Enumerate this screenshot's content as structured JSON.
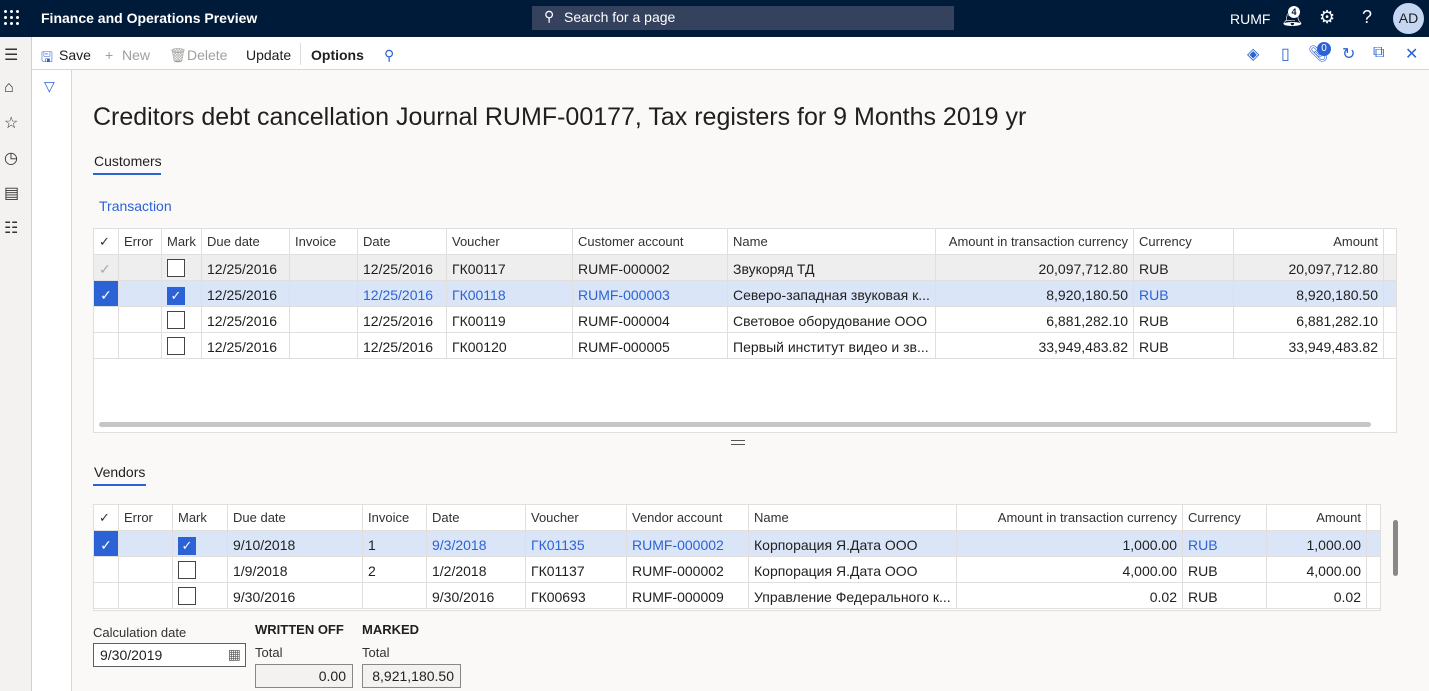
{
  "header": {
    "app_title": "Finance and Operations Preview",
    "search_placeholder": "Search for a page",
    "company": "RUMF",
    "notification_count": "4",
    "avatar_initials": "AD"
  },
  "actions": {
    "save": "Save",
    "new": "New",
    "delete": "Delete",
    "update": "Update",
    "options": "Options",
    "attachments_count": "0"
  },
  "page_title": "Creditors debt cancellation Journal RUMF-00177, Tax registers for 9 Months 2019 yr",
  "customers": {
    "section": "Customers",
    "tab": "Transaction",
    "columns": [
      "Error",
      "Mark",
      "Due date",
      "Invoice",
      "Date",
      "Voucher",
      "Customer account",
      "Name",
      "Amount in transaction currency",
      "Currency",
      "Amount"
    ],
    "rows": [
      {
        "selected": false,
        "marked": false,
        "due_date": "12/25/2016",
        "invoice": "",
        "date": "12/25/2016",
        "voucher": "ГК00117",
        "account": "RUMF-000002",
        "name": "Звукоряд ТД",
        "amount_tx": "20,097,712.80",
        "currency": "RUB",
        "amount": "20,097,712.80"
      },
      {
        "selected": true,
        "marked": true,
        "due_date": "12/25/2016",
        "invoice": "",
        "date": "12/25/2016",
        "voucher": "ГК00118",
        "account": "RUMF-000003",
        "name": "Северо-западная звуковая к...",
        "amount_tx": "8,920,180.50",
        "currency": "RUB",
        "amount": "8,920,180.50"
      },
      {
        "selected": false,
        "marked": false,
        "due_date": "12/25/2016",
        "invoice": "",
        "date": "12/25/2016",
        "voucher": "ГК00119",
        "account": "RUMF-000004",
        "name": "Световое оборудование ООО",
        "amount_tx": "6,881,282.10",
        "currency": "RUB",
        "amount": "6,881,282.10"
      },
      {
        "selected": false,
        "marked": false,
        "due_date": "12/25/2016",
        "invoice": "",
        "date": "12/25/2016",
        "voucher": "ГК00120",
        "account": "RUMF-000005",
        "name": "Первый институт видео и зв...",
        "amount_tx": "33,949,483.82",
        "currency": "RUB",
        "amount": "33,949,483.82"
      }
    ]
  },
  "vendors": {
    "section": "Vendors",
    "columns": [
      "Error",
      "Mark",
      "Due date",
      "Invoice",
      "Date",
      "Voucher",
      "Vendor account",
      "Name",
      "Amount in transaction currency",
      "Currency",
      "Amount"
    ],
    "rows": [
      {
        "selected": true,
        "marked": true,
        "due_date": "9/10/2018",
        "invoice": "1",
        "date": "9/3/2018",
        "voucher": "ГК01135",
        "account": "RUMF-000002",
        "name": "Корпорация Я.Дата ООО",
        "amount_tx": "1,000.00",
        "currency": "RUB",
        "amount": "1,000.00"
      },
      {
        "selected": false,
        "marked": false,
        "due_date": "1/9/2018",
        "invoice": "2",
        "date": "1/2/2018",
        "voucher": "ГК01137",
        "account": "RUMF-000002",
        "name": "Корпорация Я.Дата ООО",
        "amount_tx": "4,000.00",
        "currency": "RUB",
        "amount": "4,000.00"
      },
      {
        "selected": false,
        "marked": false,
        "due_date": "9/30/2016",
        "invoice": "",
        "date": "9/30/2016",
        "voucher": "ГК00693",
        "account": "RUMF-000009",
        "name": "Управление Федерального к...",
        "amount_tx": "0.02",
        "currency": "RUB",
        "amount": "0.02"
      }
    ]
  },
  "footer": {
    "calc_date_label": "Calculation date",
    "calc_date": "9/30/2019",
    "written_off": "WRITTEN OFF",
    "marked": "MARKED",
    "total_label": "Total",
    "written_off_total": "0.00",
    "marked_total": "8,921,180.50"
  }
}
